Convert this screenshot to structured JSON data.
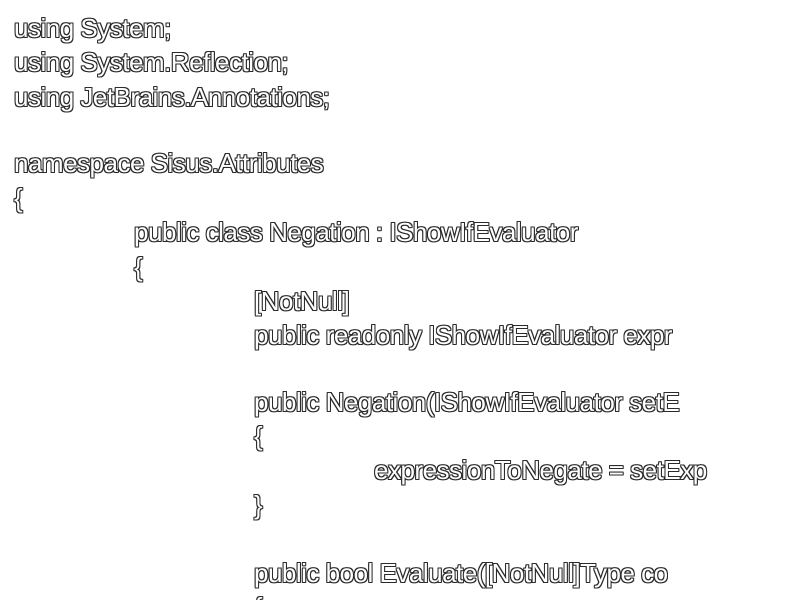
{
  "code": {
    "lines": [
      "using System;",
      "using System.Reflection;",
      "using JetBrains.Annotations;",
      "namespace Sisus.Attributes",
      "{",
      "public class Negation : IShowIfEvaluator",
      "{",
      "[NotNull]",
      "public readonly IShowIfEvaluator expr",
      "public Negation(IShowIfEvaluator setE",
      "{",
      "expressionToNegate = setExp",
      "}",
      "public bool Evaluate([NotNull]Type co",
      "{"
    ]
  }
}
